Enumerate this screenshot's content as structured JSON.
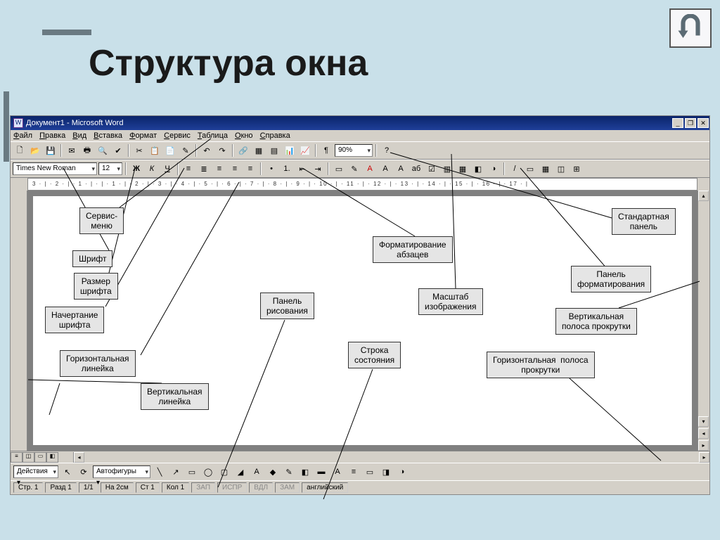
{
  "slide": {
    "title": "Структура окна"
  },
  "word": {
    "title": "Документ1 - Microsoft Word",
    "doc_icon": "W",
    "window_buttons": {
      "min": "_",
      "max": "❐",
      "close": "✕"
    },
    "menu": [
      "Файл",
      "Правка",
      "Вид",
      "Вставка",
      "Формат",
      "Сервис",
      "Таблица",
      "Окно",
      "Справка"
    ],
    "toolbar1": {
      "icons": [
        "🗋",
        "📂",
        "💾",
        "✉",
        "🖶",
        "🔍",
        "✔",
        "✂",
        "📋",
        "📄",
        "✎",
        "↶",
        "↷",
        "🔗",
        "▦",
        "▤",
        "📊",
        "📈",
        "¶"
      ],
      "zoom": "90%",
      "help": "?"
    },
    "format": {
      "font": "Times New Roman",
      "size": "12",
      "style": [
        "Ж",
        "К",
        "Ч"
      ],
      "align": [
        "≡",
        "≣",
        "≡",
        "≡",
        "≡"
      ],
      "list": [
        "•",
        "1.",
        "⇤",
        "⇥"
      ],
      "extra": [
        "▭",
        "✎",
        "A",
        "A",
        "A",
        "aб",
        "☑",
        "▥",
        "▦",
        "◧",
        "◑",
        "/",
        "▭",
        "▦",
        "◫",
        "⊞"
      ]
    },
    "ruler": "3 · | · 2 · | · 1 · | · | · 1 · | · 2 · | · 3 · | · 4 · | · 5 · | · 6 · | · 7 · | · 8 · | · 9 · | · 10 · | · 11 · | · 12 · | · 13 · | · 14 · | · 15 · | · 16 · | · 17 · |",
    "draw": {
      "action": "Действия ▾",
      "select": "↖",
      "rotate": "⟳",
      "autoshapes": "Автофигуры ▾",
      "shapes": [
        "╲",
        "↗",
        "▭",
        "◯",
        "▢",
        "◢",
        "A",
        "◆",
        "✎",
        "◧",
        "▬",
        "A",
        "≡",
        "▭",
        "◨",
        "◑",
        "◔"
      ]
    },
    "status": {
      "page": "Стр. 1",
      "section": "Разд 1",
      "pages": "1/1",
      "at": "На 2см",
      "line": "Ст 1",
      "col": "Кол 1",
      "flags": [
        "ЗАП",
        "ИСПР",
        "ВДЛ",
        "ЗАМ"
      ],
      "lang": "английский"
    }
  },
  "callouts": {
    "service_menu": "Сервис-\nменю",
    "font": "Шрифт",
    "font_size": "Размер\nшрифта",
    "font_style": "Начертание\nшрифта",
    "h_ruler": "Горизонтальная\nлинейка",
    "v_ruler": "Вертикальная\nлинейка",
    "draw_panel": "Панель\nрисования",
    "status_line": "Строка\nсостояния",
    "para_format": "Форматирование\nабзацев",
    "zoom": "Масштаб\nизображения",
    "std_panel": "Стандартная\nпанель",
    "fmt_panel": "Панель\nформатирования",
    "v_scroll": "Вертикальная\nполоса прокрутки",
    "h_scroll": "Горизонтальная  полоса\nпрокрутки"
  }
}
